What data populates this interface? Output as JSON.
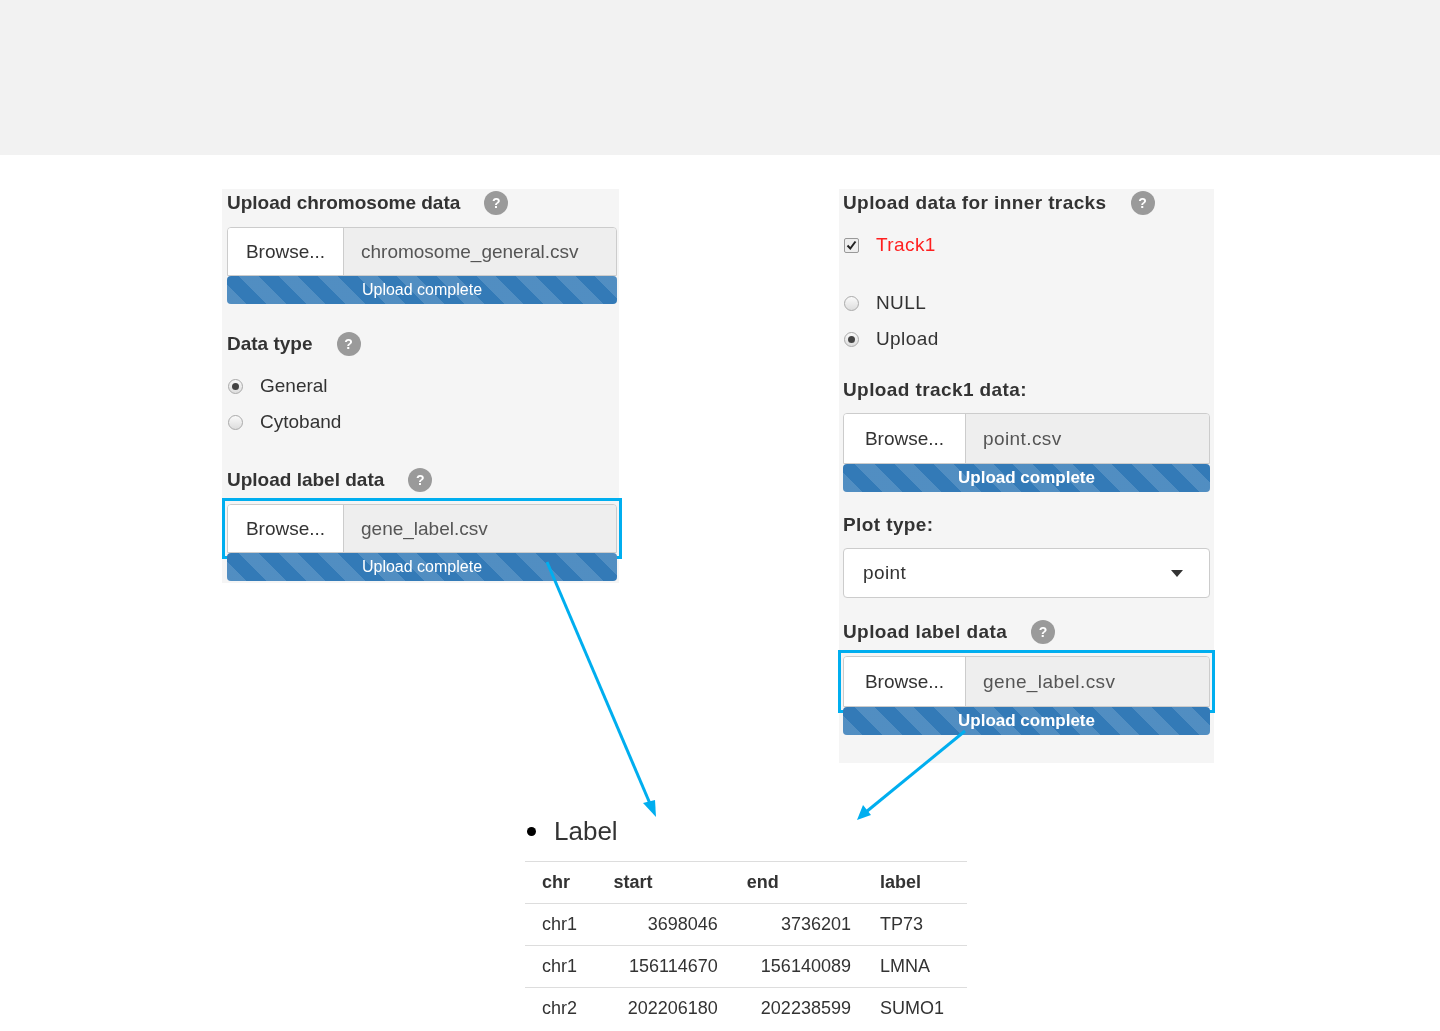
{
  "left_panel": {
    "sections": [
      {
        "kind": "file",
        "label": "Upload chromosome data",
        "help": "?",
        "button": "Browse...",
        "filename": "chromosome_general.csv",
        "progress_text": "Upload complete",
        "level": 1,
        "highlighted": false
      },
      {
        "kind": "radio",
        "label": "Data type",
        "help": "?",
        "options": [
          {
            "label": "General",
            "selected": true
          },
          {
            "label": "Cytoband",
            "selected": false
          }
        ]
      },
      {
        "kind": "file",
        "label": "Upload label data",
        "help": "?",
        "button": "Browse...",
        "filename": "gene_label.csv",
        "progress_text": "Upload complete",
        "level": 1,
        "highlighted": true
      }
    ]
  },
  "right_panel": {
    "sections": [
      {
        "kind": "checkbox",
        "label": "Upload data for inner tracks",
        "help": "?",
        "options": [
          {
            "label": "Track1",
            "checked": true
          }
        ]
      },
      {
        "kind": "radio",
        "options": [
          {
            "label": "NULL",
            "selected": false
          },
          {
            "label": "Upload",
            "selected": true
          }
        ]
      },
      {
        "kind": "file",
        "label": "Upload track1 data:",
        "button": "Browse...",
        "filename": "point.csv",
        "progress_text": "Upload complete",
        "level": 1,
        "highlighted": false
      },
      {
        "kind": "select",
        "label": "Plot type:",
        "value": "point"
      },
      {
        "kind": "file",
        "label": "Upload label data",
        "help": "?",
        "button": "Browse...",
        "filename": "gene_label.csv",
        "progress_text": "Upload complete",
        "level": 1,
        "highlighted": true
      }
    ]
  },
  "label_list": {
    "title": "Label",
    "table": {
      "columns": [
        {
          "label": "chr",
          "numeric": false
        },
        {
          "label": "start",
          "numeric": true
        },
        {
          "label": "end",
          "numeric": true
        },
        {
          "label": "label",
          "numeric": false
        }
      ],
      "rows": [
        [
          "chr1",
          "3698046",
          "3736201",
          "TP73"
        ],
        [
          "chr1",
          "156114670",
          "156140089",
          "LMNA"
        ],
        [
          "chr2",
          "202206180",
          "202238599",
          "SUMO1"
        ]
      ]
    }
  }
}
